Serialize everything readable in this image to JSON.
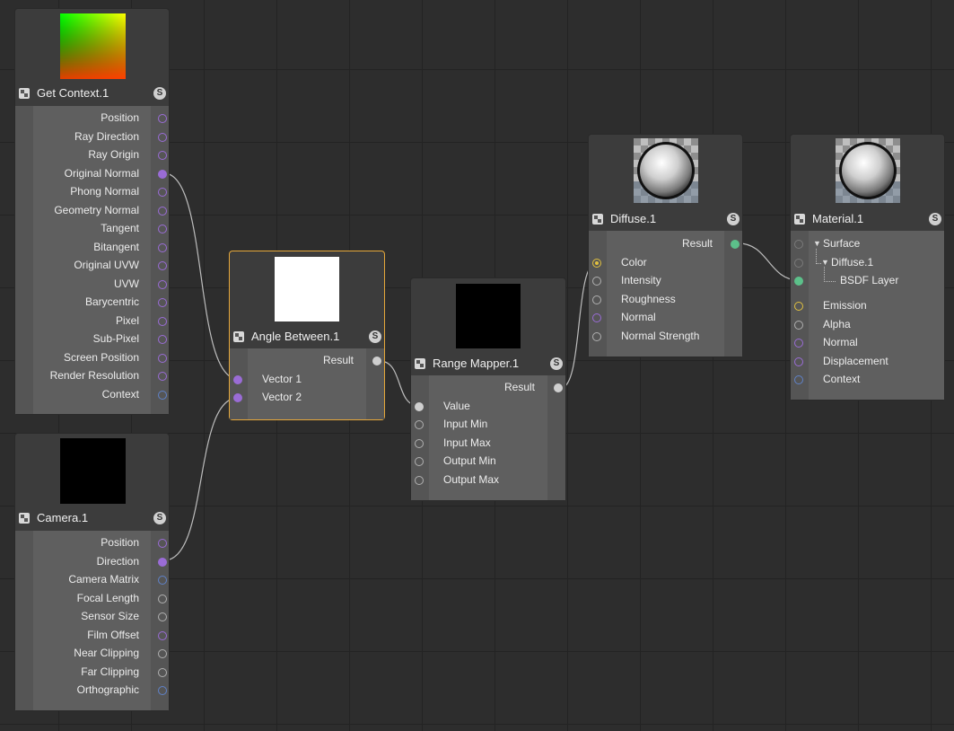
{
  "colors": {
    "canvas_bg": "#2d2d2d",
    "grid_line": "#232323",
    "node_bg": "#3c3c3c",
    "node_body": "#555555",
    "selected_border": "#e6a83a",
    "port_vector": "#9a6cd6",
    "port_matrix": "#5f82c8",
    "port_float": "#b0b0b0",
    "port_shader": "#5cc08a",
    "port_color": "#e0c040",
    "wire": "#bdbdbd"
  },
  "nodes": {
    "get_context": {
      "title": "Get Context.1",
      "badge": "S",
      "icon": "node-type-icon",
      "preview": "gradient",
      "outputs": [
        "Position",
        "Ray Direction",
        "Ray Origin",
        "Original Normal",
        "Phong Normal",
        "Geometry Normal",
        "Tangent",
        "Bitangent",
        "Original UVW",
        "UVW",
        "Barycentric",
        "Pixel",
        "Sub-Pixel",
        "Screen Position",
        "Render Resolution",
        "Context"
      ]
    },
    "camera": {
      "title": "Camera.1",
      "badge": "S",
      "icon": "node-type-icon",
      "preview": "black",
      "outputs": [
        "Position",
        "Direction",
        "Camera Matrix",
        "Focal Length",
        "Sensor Size",
        "Film Offset",
        "Near Clipping",
        "Far Clipping",
        "Orthographic"
      ]
    },
    "angle_between": {
      "title": "Angle Between.1",
      "badge": "S",
      "icon": "node-type-icon",
      "preview": "white",
      "outputs": [
        "Result"
      ],
      "inputs": [
        "Vector 1",
        "Vector 2"
      ]
    },
    "range_mapper": {
      "title": "Range Mapper.1",
      "badge": "S",
      "icon": "node-type-icon",
      "preview": "black",
      "outputs": [
        "Result"
      ],
      "inputs": [
        "Value",
        "Input Min",
        "Input Max",
        "Output Min",
        "Output Max"
      ]
    },
    "diffuse": {
      "title": "Diffuse.1",
      "badge": "S",
      "icon": "node-type-icon",
      "preview": "sphere",
      "outputs": [
        "Result"
      ],
      "inputs": [
        "Color",
        "Intensity",
        "Roughness",
        "Normal",
        "Normal Strength"
      ]
    },
    "material": {
      "title": "Material.1",
      "badge": "S",
      "icon": "node-type-icon",
      "preview": "sphere",
      "tree": [
        "Surface",
        "Diffuse.1",
        "BSDF Layer"
      ],
      "inputs": [
        "Emission",
        "Alpha",
        "Normal",
        "Displacement",
        "Context"
      ]
    }
  }
}
